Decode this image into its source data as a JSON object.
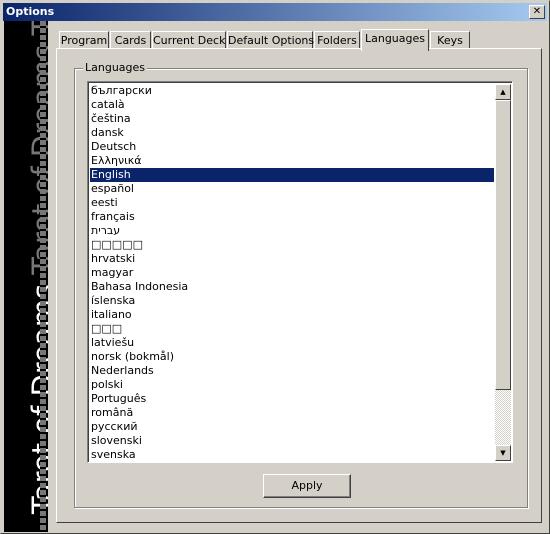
{
  "window": {
    "title": "Options",
    "close_glyph": "✕"
  },
  "banner": {
    "text_primary": "Tarot of Dreams",
    "text_secondary": "Tarot of Dreams Tarot of"
  },
  "tabs": [
    {
      "label": "Program",
      "active": false
    },
    {
      "label": "Cards",
      "active": false
    },
    {
      "label": "Current Deck",
      "active": false
    },
    {
      "label": "Default Options",
      "active": false
    },
    {
      "label": "Folders",
      "active": false
    },
    {
      "label": "Languages",
      "active": true
    },
    {
      "label": "Keys",
      "active": false
    }
  ],
  "languages_group": {
    "label": "Languages",
    "selected": "English",
    "items": [
      "български",
      "català",
      "čeština",
      "dansk",
      "Deutsch",
      "Ελληνικά",
      "English",
      "español",
      "eesti",
      "français",
      "עברית",
      "□□□□□",
      "hrvatski",
      "magyar",
      "Bahasa Indonesia",
      "íslenska",
      "italiano",
      "□□□",
      "latviešu",
      "norsk (bokmål)",
      "Nederlands",
      "polski",
      "Português",
      "română",
      "русский",
      "slovenski",
      "svenska"
    ],
    "scrollbar": {
      "up_glyph": "▲",
      "down_glyph": "▼"
    }
  },
  "buttons": {
    "apply_label": "Apply"
  },
  "colors": {
    "selection": "#0a246a",
    "face": "#d4d0c8"
  }
}
